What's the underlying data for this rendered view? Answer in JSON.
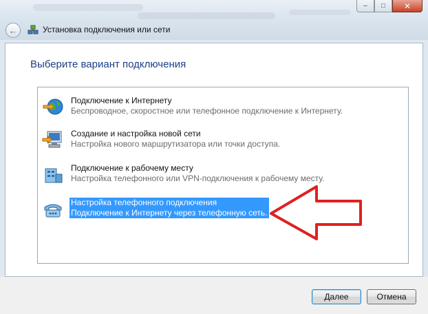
{
  "window": {
    "nav_title": "Установка подключения или сети",
    "buttons": {
      "minimize": "–",
      "maximize": "□",
      "close": "✕"
    },
    "back_icon": "back-arrow-icon"
  },
  "content": {
    "heading": "Выберите вариант подключения",
    "options": [
      {
        "title": "Подключение к Интернету",
        "desc": "Беспроводное, скоростное или телефонное подключение к Интернету.",
        "icon": "globe-network-icon",
        "selected": false
      },
      {
        "title": "Создание и настройка новой сети",
        "desc": "Настройка нового маршрутизатора или точки доступа.",
        "icon": "new-network-icon",
        "selected": false
      },
      {
        "title": "Подключение к рабочему месту",
        "desc": "Настройка телефонного или VPN-подключения к рабочему месту.",
        "icon": "workplace-icon",
        "selected": false
      },
      {
        "title": "Настройка телефонного подключения",
        "desc": "Подключение к Интернету через телефонную сеть.",
        "icon": "dialup-phone-icon",
        "selected": true
      }
    ]
  },
  "footer": {
    "next_label": "Далее",
    "cancel_label": "Отмена"
  },
  "colors": {
    "selection": "#3399ff",
    "heading": "#1d3f87",
    "arrow": "#e02020"
  }
}
